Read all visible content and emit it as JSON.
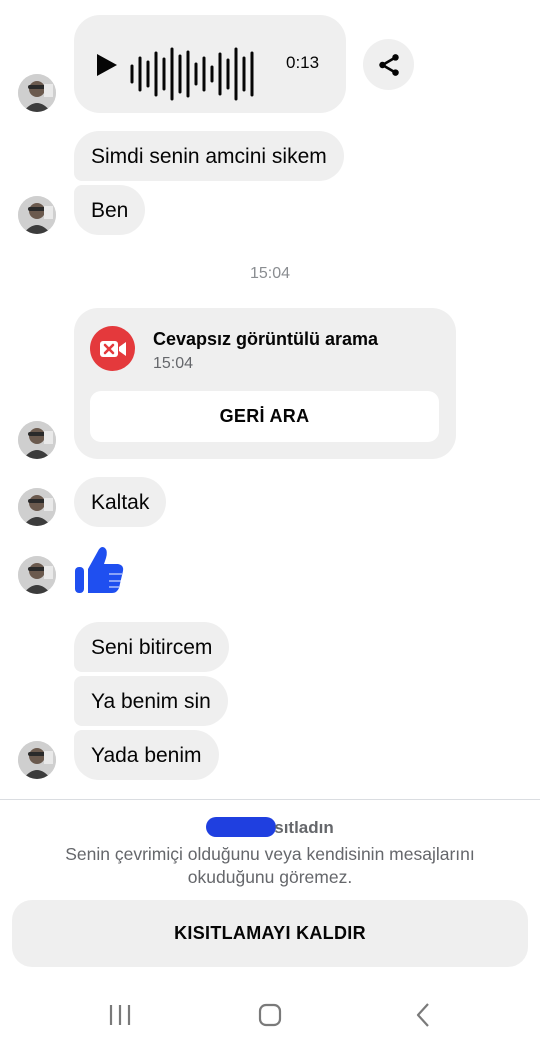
{
  "messages": {
    "voice": {
      "duration": "0:13"
    },
    "texts": [
      "Simdi senin amcini sikem",
      "Ben",
      "Kaltak",
      "Seni bitircem",
      "Ya benim sin",
      "Yada benim"
    ],
    "timestamp": "15:04",
    "missed_call": {
      "title": "Cevapsız görüntülü arama",
      "time": "15:04",
      "call_back_label": "GERİ ARA"
    },
    "like_icon": "thumbs-up-icon"
  },
  "restriction": {
    "title_suffix": "sıtladın",
    "description": "Senin çevrimiçi olduğunu veya kendisinin mesajlarını okuduğunu göremez.",
    "unrestrict_label": "KISITLAMAYI KALDIR"
  },
  "navbar": {
    "icons": [
      "recent-apps-icon",
      "home-icon",
      "back-icon"
    ]
  },
  "colors": {
    "bubble": "#efefef",
    "missed_call": "#e4393c",
    "like": "#1f4ff0",
    "secondary_text": "#65676b",
    "redaction": "#1f3fe0"
  }
}
